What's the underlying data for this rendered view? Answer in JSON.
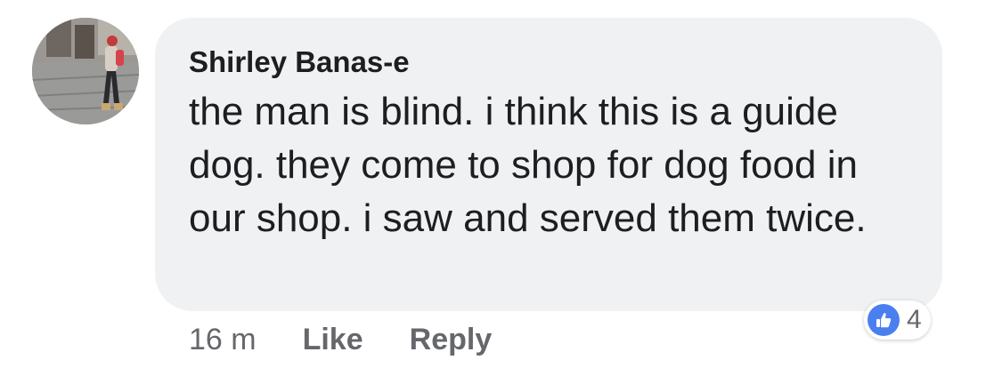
{
  "comment": {
    "author": "Shirley Banas-e",
    "text": "the man is blind. i think this is a guide dog. they come to shop for dog food in our shop. i saw and served them twice.",
    "timestamp": "16 m",
    "like_label": "Like",
    "reply_label": "Reply",
    "reaction_count": "4",
    "reaction_icon": "thumbs-up-icon"
  },
  "colors": {
    "bubble": "#f0f1f3",
    "text": "#1c1e21",
    "meta": "#65676b",
    "like_blue": "#4a7ff0"
  }
}
